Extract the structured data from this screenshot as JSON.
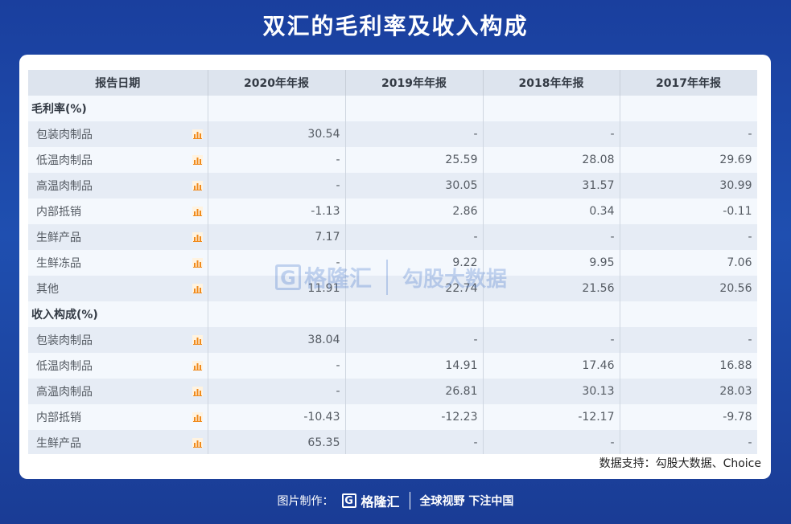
{
  "title": "双汇的毛利率及收入构成",
  "table": {
    "headers": [
      "报告日期",
      "2020年年报",
      "2019年年报",
      "2018年年报",
      "2017年年报"
    ],
    "sections": [
      {
        "name": "毛利率(%)",
        "rows": [
          {
            "label": "包装肉制品",
            "values": [
              "30.54",
              "-",
              "-",
              "-"
            ]
          },
          {
            "label": "低温肉制品",
            "values": [
              "-",
              "25.59",
              "28.08",
              "29.69"
            ]
          },
          {
            "label": "高温肉制品",
            "values": [
              "-",
              "30.05",
              "31.57",
              "30.99"
            ]
          },
          {
            "label": "内部抵销",
            "values": [
              "-1.13",
              "2.86",
              "0.34",
              "-0.11"
            ]
          },
          {
            "label": "生鲜产品",
            "values": [
              "7.17",
              "-",
              "-",
              "-"
            ]
          },
          {
            "label": "生鲜冻品",
            "values": [
              "-",
              "9.22",
              "9.95",
              "7.06"
            ]
          },
          {
            "label": "其他",
            "values": [
              "11.91",
              "22.74",
              "21.56",
              "20.56"
            ]
          }
        ]
      },
      {
        "name": "收入构成(%)",
        "rows": [
          {
            "label": "包装肉制品",
            "values": [
              "38.04",
              "-",
              "-",
              "-"
            ]
          },
          {
            "label": "低温肉制品",
            "values": [
              "-",
              "14.91",
              "17.46",
              "16.88"
            ]
          },
          {
            "label": "高温肉制品",
            "values": [
              "-",
              "26.81",
              "30.13",
              "28.03"
            ]
          },
          {
            "label": "内部抵销",
            "values": [
              "-10.43",
              "-12.23",
              "-12.17",
              "-9.78"
            ]
          },
          {
            "label": "生鲜产品",
            "values": [
              "65.35",
              "-",
              "-",
              "-"
            ]
          }
        ]
      }
    ]
  },
  "source": "数据支持：勾股大数据、Choice",
  "watermark": {
    "logo_letter": "G",
    "brand": "格隆汇",
    "cn": "勾股大数据"
  },
  "footer": {
    "made_by": "图片制作：",
    "logo_letter": "G",
    "brand": "格隆汇",
    "slogan": "全球视野 下注中国"
  },
  "colors": {
    "background": "#1f4fb0",
    "header_row": "#dde4ee",
    "row_light": "#f4f8fd",
    "row_alt": "#e6ecf5",
    "chart_icon": "#f08a1c"
  }
}
